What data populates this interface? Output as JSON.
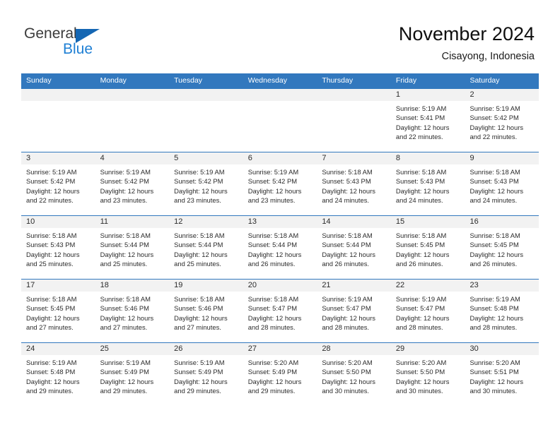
{
  "brand": {
    "name_part1": "General",
    "name_part2": "Blue",
    "triangle_color": "#1466b3",
    "blue_color": "#1e7fd4"
  },
  "header": {
    "title": "November 2024",
    "subtitle": "Cisayong, Indonesia"
  },
  "theme": {
    "header_bar_color": "#3278be",
    "day_band_color": "#f2f2f2",
    "text_color": "#2b2b2b"
  },
  "calendar": {
    "weekdays": [
      "Sunday",
      "Monday",
      "Tuesday",
      "Wednesday",
      "Thursday",
      "Friday",
      "Saturday"
    ],
    "weeks": [
      [
        {
          "day": "",
          "lines": []
        },
        {
          "day": "",
          "lines": []
        },
        {
          "day": "",
          "lines": []
        },
        {
          "day": "",
          "lines": []
        },
        {
          "day": "",
          "lines": []
        },
        {
          "day": "1",
          "lines": [
            "Sunrise: 5:19 AM",
            "Sunset: 5:41 PM",
            "Daylight: 12 hours",
            "and 22 minutes."
          ]
        },
        {
          "day": "2",
          "lines": [
            "Sunrise: 5:19 AM",
            "Sunset: 5:42 PM",
            "Daylight: 12 hours",
            "and 22 minutes."
          ]
        }
      ],
      [
        {
          "day": "3",
          "lines": [
            "Sunrise: 5:19 AM",
            "Sunset: 5:42 PM",
            "Daylight: 12 hours",
            "and 22 minutes."
          ]
        },
        {
          "day": "4",
          "lines": [
            "Sunrise: 5:19 AM",
            "Sunset: 5:42 PM",
            "Daylight: 12 hours",
            "and 23 minutes."
          ]
        },
        {
          "day": "5",
          "lines": [
            "Sunrise: 5:19 AM",
            "Sunset: 5:42 PM",
            "Daylight: 12 hours",
            "and 23 minutes."
          ]
        },
        {
          "day": "6",
          "lines": [
            "Sunrise: 5:19 AM",
            "Sunset: 5:42 PM",
            "Daylight: 12 hours",
            "and 23 minutes."
          ]
        },
        {
          "day": "7",
          "lines": [
            "Sunrise: 5:18 AM",
            "Sunset: 5:43 PM",
            "Daylight: 12 hours",
            "and 24 minutes."
          ]
        },
        {
          "day": "8",
          "lines": [
            "Sunrise: 5:18 AM",
            "Sunset: 5:43 PM",
            "Daylight: 12 hours",
            "and 24 minutes."
          ]
        },
        {
          "day": "9",
          "lines": [
            "Sunrise: 5:18 AM",
            "Sunset: 5:43 PM",
            "Daylight: 12 hours",
            "and 24 minutes."
          ]
        }
      ],
      [
        {
          "day": "10",
          "lines": [
            "Sunrise: 5:18 AM",
            "Sunset: 5:43 PM",
            "Daylight: 12 hours",
            "and 25 minutes."
          ]
        },
        {
          "day": "11",
          "lines": [
            "Sunrise: 5:18 AM",
            "Sunset: 5:44 PM",
            "Daylight: 12 hours",
            "and 25 minutes."
          ]
        },
        {
          "day": "12",
          "lines": [
            "Sunrise: 5:18 AM",
            "Sunset: 5:44 PM",
            "Daylight: 12 hours",
            "and 25 minutes."
          ]
        },
        {
          "day": "13",
          "lines": [
            "Sunrise: 5:18 AM",
            "Sunset: 5:44 PM",
            "Daylight: 12 hours",
            "and 26 minutes."
          ]
        },
        {
          "day": "14",
          "lines": [
            "Sunrise: 5:18 AM",
            "Sunset: 5:44 PM",
            "Daylight: 12 hours",
            "and 26 minutes."
          ]
        },
        {
          "day": "15",
          "lines": [
            "Sunrise: 5:18 AM",
            "Sunset: 5:45 PM",
            "Daylight: 12 hours",
            "and 26 minutes."
          ]
        },
        {
          "day": "16",
          "lines": [
            "Sunrise: 5:18 AM",
            "Sunset: 5:45 PM",
            "Daylight: 12 hours",
            "and 26 minutes."
          ]
        }
      ],
      [
        {
          "day": "17",
          "lines": [
            "Sunrise: 5:18 AM",
            "Sunset: 5:45 PM",
            "Daylight: 12 hours",
            "and 27 minutes."
          ]
        },
        {
          "day": "18",
          "lines": [
            "Sunrise: 5:18 AM",
            "Sunset: 5:46 PM",
            "Daylight: 12 hours",
            "and 27 minutes."
          ]
        },
        {
          "day": "19",
          "lines": [
            "Sunrise: 5:18 AM",
            "Sunset: 5:46 PM",
            "Daylight: 12 hours",
            "and 27 minutes."
          ]
        },
        {
          "day": "20",
          "lines": [
            "Sunrise: 5:18 AM",
            "Sunset: 5:47 PM",
            "Daylight: 12 hours",
            "and 28 minutes."
          ]
        },
        {
          "day": "21",
          "lines": [
            "Sunrise: 5:19 AM",
            "Sunset: 5:47 PM",
            "Daylight: 12 hours",
            "and 28 minutes."
          ]
        },
        {
          "day": "22",
          "lines": [
            "Sunrise: 5:19 AM",
            "Sunset: 5:47 PM",
            "Daylight: 12 hours",
            "and 28 minutes."
          ]
        },
        {
          "day": "23",
          "lines": [
            "Sunrise: 5:19 AM",
            "Sunset: 5:48 PM",
            "Daylight: 12 hours",
            "and 28 minutes."
          ]
        }
      ],
      [
        {
          "day": "24",
          "lines": [
            "Sunrise: 5:19 AM",
            "Sunset: 5:48 PM",
            "Daylight: 12 hours",
            "and 29 minutes."
          ]
        },
        {
          "day": "25",
          "lines": [
            "Sunrise: 5:19 AM",
            "Sunset: 5:49 PM",
            "Daylight: 12 hours",
            "and 29 minutes."
          ]
        },
        {
          "day": "26",
          "lines": [
            "Sunrise: 5:19 AM",
            "Sunset: 5:49 PM",
            "Daylight: 12 hours",
            "and 29 minutes."
          ]
        },
        {
          "day": "27",
          "lines": [
            "Sunrise: 5:20 AM",
            "Sunset: 5:49 PM",
            "Daylight: 12 hours",
            "and 29 minutes."
          ]
        },
        {
          "day": "28",
          "lines": [
            "Sunrise: 5:20 AM",
            "Sunset: 5:50 PM",
            "Daylight: 12 hours",
            "and 30 minutes."
          ]
        },
        {
          "day": "29",
          "lines": [
            "Sunrise: 5:20 AM",
            "Sunset: 5:50 PM",
            "Daylight: 12 hours",
            "and 30 minutes."
          ]
        },
        {
          "day": "30",
          "lines": [
            "Sunrise: 5:20 AM",
            "Sunset: 5:51 PM",
            "Daylight: 12 hours",
            "and 30 minutes."
          ]
        }
      ]
    ]
  }
}
